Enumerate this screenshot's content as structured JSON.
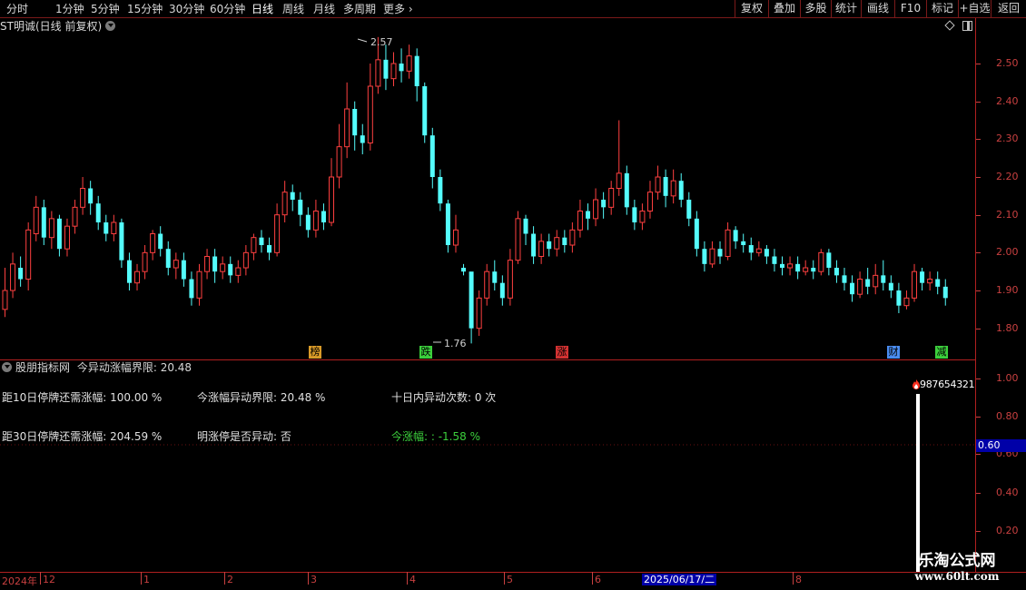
{
  "toolbar": {
    "periods": [
      "分时",
      "1分钟",
      "5分钟",
      "15分钟",
      "30分钟",
      "60分钟",
      "日线",
      "周线",
      "月线",
      "多周期",
      "更多"
    ],
    "active_period": "日线",
    "more_chevron": "›",
    "buttons": [
      "复权",
      "叠加",
      "多股",
      "统计",
      "画线",
      "F10",
      "标记",
      "+自选",
      "返回"
    ]
  },
  "price_pane": {
    "title": "ST明诚(日线 前复权)",
    "high_label": "2.57",
    "low_label": "1.76",
    "y_ticks": [
      "2.50",
      "2.40",
      "2.30",
      "2.20",
      "2.10",
      "2.00",
      "1.90",
      "1.80"
    ],
    "markers": [
      {
        "text": "榜",
        "color": "#d99a28"
      },
      {
        "text": "跌",
        "color": "#3ccf3c"
      },
      {
        "text": "涨",
        "color": "#d23232"
      },
      {
        "text": "财",
        "color": "#4a8cf0"
      },
      {
        "text": "减",
        "color": "#3ccf3c"
      }
    ]
  },
  "indicator_pane": {
    "title": "股朋指标网",
    "subtitle": "今异动涨幅界限: 20.48",
    "row1": {
      "a": "距10日停牌还需涨幅: 100.00 %",
      "b": "今涨幅异动界限: 20.48 %",
      "c": "十日内异动次数: 0 次"
    },
    "row2": {
      "a": "距30日停牌还需涨幅: 204.59 %",
      "b": "明涨停是否异动: 否",
      "c": "今涨幅: : -1.58 %"
    },
    "y_ticks": [
      "1.00",
      "0.80",
      "0.60",
      "0.40",
      "0.20"
    ],
    "current_value": "0.60",
    "alert_label": "987654321"
  },
  "x_axis": {
    "labels": [
      "2024年",
      "12",
      "1",
      "2",
      "3",
      "4",
      "5",
      "6",
      "8"
    ],
    "crosshair_date": "2025/06/17/二"
  },
  "watermark": {
    "title": "乐淘公式网",
    "url": "www.60lt.com"
  },
  "colors": {
    "up": "#ff4040",
    "down": "#54fcfc",
    "accent_red": "#b02020",
    "highlight_blue": "#0000a8"
  },
  "chart_data": {
    "type": "candlestick",
    "title": "ST明诚(日线 前复权)",
    "ylim": [
      1.74,
      2.62
    ],
    "high_marker": 2.57,
    "low_marker": 1.76,
    "candles": [
      [
        1.85,
        1.9,
        1.83,
        1.96
      ],
      [
        1.9,
        1.97,
        1.88,
        2.0
      ],
      [
        1.96,
        1.93,
        1.91,
        1.99
      ],
      [
        1.93,
        2.06,
        1.9,
        2.08
      ],
      [
        2.05,
        2.12,
        2.03,
        2.15
      ],
      [
        2.12,
        2.04,
        2.02,
        2.14
      ],
      [
        2.04,
        2.09,
        2.01,
        2.11
      ],
      [
        2.09,
        2.01,
        1.99,
        2.1
      ],
      [
        2.01,
        2.07,
        1.99,
        2.09
      ],
      [
        2.07,
        2.12,
        2.05,
        2.14
      ],
      [
        2.12,
        2.17,
        2.1,
        2.2
      ],
      [
        2.17,
        2.13,
        2.1,
        2.19
      ],
      [
        2.13,
        2.08,
        2.06,
        2.15
      ],
      [
        2.08,
        2.05,
        2.03,
        2.1
      ],
      [
        2.05,
        2.08,
        2.03,
        2.1
      ],
      [
        2.08,
        1.98,
        1.96,
        2.09
      ],
      [
        1.98,
        1.92,
        1.9,
        2.0
      ],
      [
        1.92,
        1.95,
        1.9,
        1.97
      ],
      [
        1.95,
        2.0,
        1.93,
        2.02
      ],
      [
        2.0,
        2.05,
        1.98,
        2.06
      ],
      [
        2.05,
        2.01,
        1.99,
        2.07
      ],
      [
        2.01,
        1.96,
        1.94,
        2.03
      ],
      [
        1.96,
        1.98,
        1.93,
        2.0
      ],
      [
        1.98,
        1.93,
        1.91,
        2.0
      ],
      [
        1.93,
        1.88,
        1.86,
        1.95
      ],
      [
        1.88,
        1.95,
        1.86,
        1.97
      ],
      [
        1.95,
        1.99,
        1.93,
        2.01
      ],
      [
        1.99,
        1.95,
        1.92,
        2.01
      ],
      [
        1.95,
        1.97,
        1.93,
        1.99
      ],
      [
        1.97,
        1.94,
        1.92,
        1.99
      ],
      [
        1.94,
        1.96,
        1.92,
        1.98
      ],
      [
        1.96,
        2.0,
        1.94,
        2.02
      ],
      [
        2.0,
        2.04,
        1.98,
        2.05
      ],
      [
        2.04,
        2.02,
        2.0,
        2.06
      ],
      [
        2.02,
        2.0,
        1.98,
        2.04
      ],
      [
        2.0,
        2.1,
        1.99,
        2.13
      ],
      [
        2.1,
        2.16,
        2.08,
        2.19
      ],
      [
        2.16,
        2.14,
        2.11,
        2.18
      ],
      [
        2.14,
        2.1,
        2.07,
        2.16
      ],
      [
        2.1,
        2.06,
        2.04,
        2.12
      ],
      [
        2.06,
        2.11,
        2.04,
        2.14
      ],
      [
        2.11,
        2.08,
        2.06,
        2.13
      ],
      [
        2.08,
        2.2,
        2.07,
        2.25
      ],
      [
        2.2,
        2.28,
        2.17,
        2.34
      ],
      [
        2.28,
        2.38,
        2.25,
        2.45
      ],
      [
        2.38,
        2.31,
        2.27,
        2.4
      ],
      [
        2.31,
        2.29,
        2.26,
        2.34
      ],
      [
        2.29,
        2.44,
        2.27,
        2.5
      ],
      [
        2.44,
        2.51,
        2.42,
        2.57
      ],
      [
        2.51,
        2.46,
        2.43,
        2.55
      ],
      [
        2.46,
        2.5,
        2.44,
        2.53
      ],
      [
        2.5,
        2.48,
        2.45,
        2.54
      ],
      [
        2.48,
        2.52,
        2.46,
        2.55
      ],
      [
        2.52,
        2.44,
        2.4,
        2.54
      ],
      [
        2.44,
        2.31,
        2.29,
        2.45
      ],
      [
        2.31,
        2.2,
        2.17,
        2.33
      ],
      [
        2.2,
        2.13,
        2.11,
        2.22
      ],
      [
        2.13,
        2.02,
        2.0,
        2.14
      ],
      [
        2.02,
        2.06,
        2.0,
        2.1
      ],
      [
        1.96,
        1.95,
        1.94,
        1.97
      ],
      [
        1.95,
        1.8,
        1.76,
        1.92
      ],
      [
        1.8,
        1.88,
        1.78,
        1.9
      ],
      [
        1.88,
        1.95,
        1.86,
        1.97
      ],
      [
        1.95,
        1.92,
        1.9,
        1.98
      ],
      [
        1.92,
        1.88,
        1.86,
        1.94
      ],
      [
        1.88,
        1.98,
        1.86,
        2.01
      ],
      [
        1.98,
        2.09,
        1.97,
        2.11
      ],
      [
        2.09,
        2.05,
        2.02,
        2.1
      ],
      [
        2.05,
        1.99,
        1.97,
        2.07
      ],
      [
        1.99,
        2.03,
        1.97,
        2.05
      ],
      [
        2.03,
        2.01,
        1.99,
        2.05
      ],
      [
        2.01,
        2.04,
        1.99,
        2.06
      ],
      [
        2.04,
        2.02,
        2.0,
        2.06
      ],
      [
        2.02,
        2.06,
        2.0,
        2.08
      ],
      [
        2.06,
        2.11,
        2.04,
        2.14
      ],
      [
        2.11,
        2.09,
        2.06,
        2.13
      ],
      [
        2.09,
        2.14,
        2.07,
        2.17
      ],
      [
        2.14,
        2.12,
        2.09,
        2.16
      ],
      [
        2.12,
        2.17,
        2.1,
        2.19
      ],
      [
        2.17,
        2.21,
        2.15,
        2.35
      ],
      [
        2.21,
        2.12,
        2.1,
        2.23
      ],
      [
        2.12,
        2.08,
        2.06,
        2.14
      ],
      [
        2.08,
        2.11,
        2.06,
        2.13
      ],
      [
        2.11,
        2.16,
        2.09,
        2.19
      ],
      [
        2.16,
        2.2,
        2.14,
        2.23
      ],
      [
        2.2,
        2.15,
        2.12,
        2.22
      ],
      [
        2.15,
        2.19,
        2.13,
        2.22
      ],
      [
        2.19,
        2.14,
        2.12,
        2.21
      ],
      [
        2.14,
        2.09,
        2.07,
        2.16
      ],
      [
        2.09,
        2.01,
        1.99,
        2.11
      ],
      [
        2.01,
        1.97,
        1.95,
        2.03
      ],
      [
        1.97,
        2.01,
        1.96,
        2.03
      ],
      [
        2.01,
        1.99,
        1.97,
        2.03
      ],
      [
        1.99,
        2.06,
        1.98,
        2.08
      ],
      [
        2.06,
        2.03,
        2.01,
        2.07
      ],
      [
        2.03,
        2.02,
        2.0,
        2.05
      ],
      [
        2.02,
        2.0,
        1.98,
        2.04
      ],
      [
        2.0,
        2.01,
        1.99,
        2.03
      ],
      [
        2.01,
        1.99,
        1.97,
        2.02
      ],
      [
        1.99,
        1.97,
        1.95,
        2.01
      ],
      [
        1.97,
        1.96,
        1.94,
        1.99
      ],
      [
        1.96,
        1.97,
        1.94,
        1.99
      ],
      [
        1.97,
        1.95,
        1.93,
        1.99
      ],
      [
        1.95,
        1.96,
        1.94,
        1.98
      ],
      [
        1.96,
        1.95,
        1.93,
        1.98
      ],
      [
        1.95,
        2.0,
        1.94,
        2.01
      ],
      [
        2.0,
        1.96,
        1.94,
        2.01
      ],
      [
        1.96,
        1.94,
        1.92,
        1.98
      ],
      [
        1.94,
        1.92,
        1.9,
        1.96
      ],
      [
        1.92,
        1.89,
        1.87,
        1.94
      ],
      [
        1.89,
        1.93,
        1.88,
        1.95
      ],
      [
        1.93,
        1.91,
        1.89,
        1.96
      ],
      [
        1.91,
        1.94,
        1.89,
        1.97
      ],
      [
        1.94,
        1.92,
        1.9,
        1.98
      ],
      [
        1.92,
        1.9,
        1.88,
        1.94
      ],
      [
        1.9,
        1.86,
        1.84,
        1.92
      ],
      [
        1.86,
        1.88,
        1.85,
        1.9
      ],
      [
        1.88,
        1.95,
        1.87,
        1.97
      ],
      [
        1.95,
        1.92,
        1.9,
        1.96
      ],
      [
        1.92,
        1.93,
        1.9,
        1.95
      ],
      [
        1.93,
        1.91,
        1.89,
        1.95
      ],
      [
        1.91,
        1.88,
        1.86,
        1.93
      ]
    ]
  }
}
